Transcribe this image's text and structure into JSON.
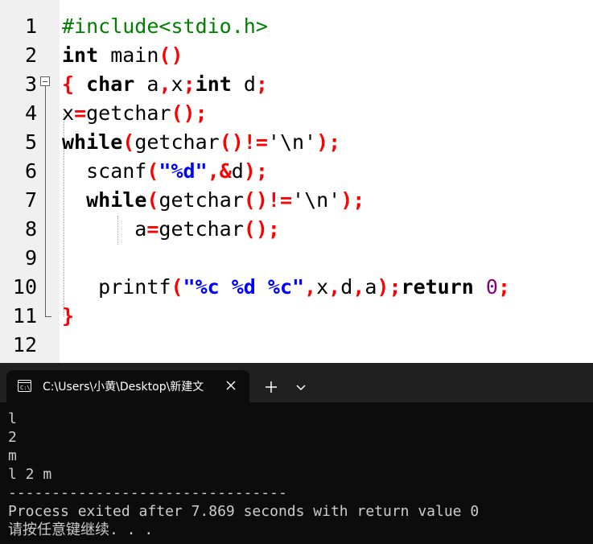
{
  "editor": {
    "line_numbers": [
      "1",
      "2",
      "3",
      "4",
      "5",
      "6",
      "7",
      "8",
      "9",
      "10",
      "11",
      "12"
    ],
    "lines": [
      [
        {
          "t": "#include<stdio.h>",
          "c": "pp"
        }
      ],
      [
        {
          "t": "int",
          "c": "kw"
        },
        {
          "t": " main",
          "c": ""
        },
        {
          "t": "()",
          "c": "sym"
        }
      ],
      [
        {
          "t": "{",
          "c": "sym"
        },
        {
          "t": " ",
          "c": ""
        },
        {
          "t": "char",
          "c": "kw"
        },
        {
          "t": " a",
          "c": ""
        },
        {
          "t": ",",
          "c": "sym"
        },
        {
          "t": "x",
          "c": ""
        },
        {
          "t": ";",
          "c": "sym"
        },
        {
          "t": "int",
          "c": "kw"
        },
        {
          "t": " d",
          "c": ""
        },
        {
          "t": ";",
          "c": "sym"
        }
      ],
      [
        {
          "t": "x",
          "c": ""
        },
        {
          "t": "=",
          "c": "sym"
        },
        {
          "t": "getchar",
          "c": ""
        },
        {
          "t": "();",
          "c": "sym"
        }
      ],
      [
        {
          "t": "while",
          "c": "kw"
        },
        {
          "t": "(",
          "c": "sym"
        },
        {
          "t": "getchar",
          "c": ""
        },
        {
          "t": "()!=",
          "c": "sym"
        },
        {
          "t": "'\\n'",
          "c": ""
        },
        {
          "t": ");",
          "c": "sym"
        }
      ],
      [
        {
          "t": "  scanf",
          "c": ""
        },
        {
          "t": "(",
          "c": "sym"
        },
        {
          "t": "\"%d\"",
          "c": "str"
        },
        {
          "t": ",&",
          "c": "sym"
        },
        {
          "t": "d",
          "c": ""
        },
        {
          "t": ");",
          "c": "sym"
        }
      ],
      [
        {
          "t": "  ",
          "c": ""
        },
        {
          "t": "while",
          "c": "kw"
        },
        {
          "t": "(",
          "c": "sym"
        },
        {
          "t": "getchar",
          "c": ""
        },
        {
          "t": "()!=",
          "c": "sym"
        },
        {
          "t": "'\\n'",
          "c": ""
        },
        {
          "t": ");",
          "c": "sym"
        }
      ],
      [
        {
          "t": "      a",
          "c": ""
        },
        {
          "t": "=",
          "c": "sym"
        },
        {
          "t": "getchar",
          "c": ""
        },
        {
          "t": "();",
          "c": "sym"
        }
      ],
      [],
      [
        {
          "t": "   printf",
          "c": ""
        },
        {
          "t": "(",
          "c": "sym"
        },
        {
          "t": "\"%c %d %c\"",
          "c": "str"
        },
        {
          "t": ",",
          "c": "sym"
        },
        {
          "t": "x",
          "c": ""
        },
        {
          "t": ",",
          "c": "sym"
        },
        {
          "t": "d",
          "c": ""
        },
        {
          "t": ",",
          "c": "sym"
        },
        {
          "t": "a",
          "c": ""
        },
        {
          "t": ");",
          "c": "sym"
        },
        {
          "t": "return",
          "c": "kw"
        },
        {
          "t": " ",
          "c": ""
        },
        {
          "t": "0",
          "c": "num"
        },
        {
          "t": ";",
          "c": "sym"
        }
      ],
      [
        {
          "t": "}",
          "c": "sym"
        }
      ],
      []
    ]
  },
  "terminal": {
    "tab_title": "C:\\Users\\小黄\\Desktop\\新建文",
    "new_tab_label": "+",
    "output": [
      "l",
      "2",
      "m",
      "l 2 m",
      "--------------------------------",
      "Process exited after 7.869 seconds with return value 0",
      "请按任意键继续. . ."
    ]
  },
  "colors": {
    "keyword": "#000000",
    "symbol": "#ff0000",
    "preprocessor": "#008000",
    "string": "#0000ff",
    "number": "#800080",
    "terminal_bg": "#0c0c0c",
    "terminal_text": "#cccccc"
  }
}
